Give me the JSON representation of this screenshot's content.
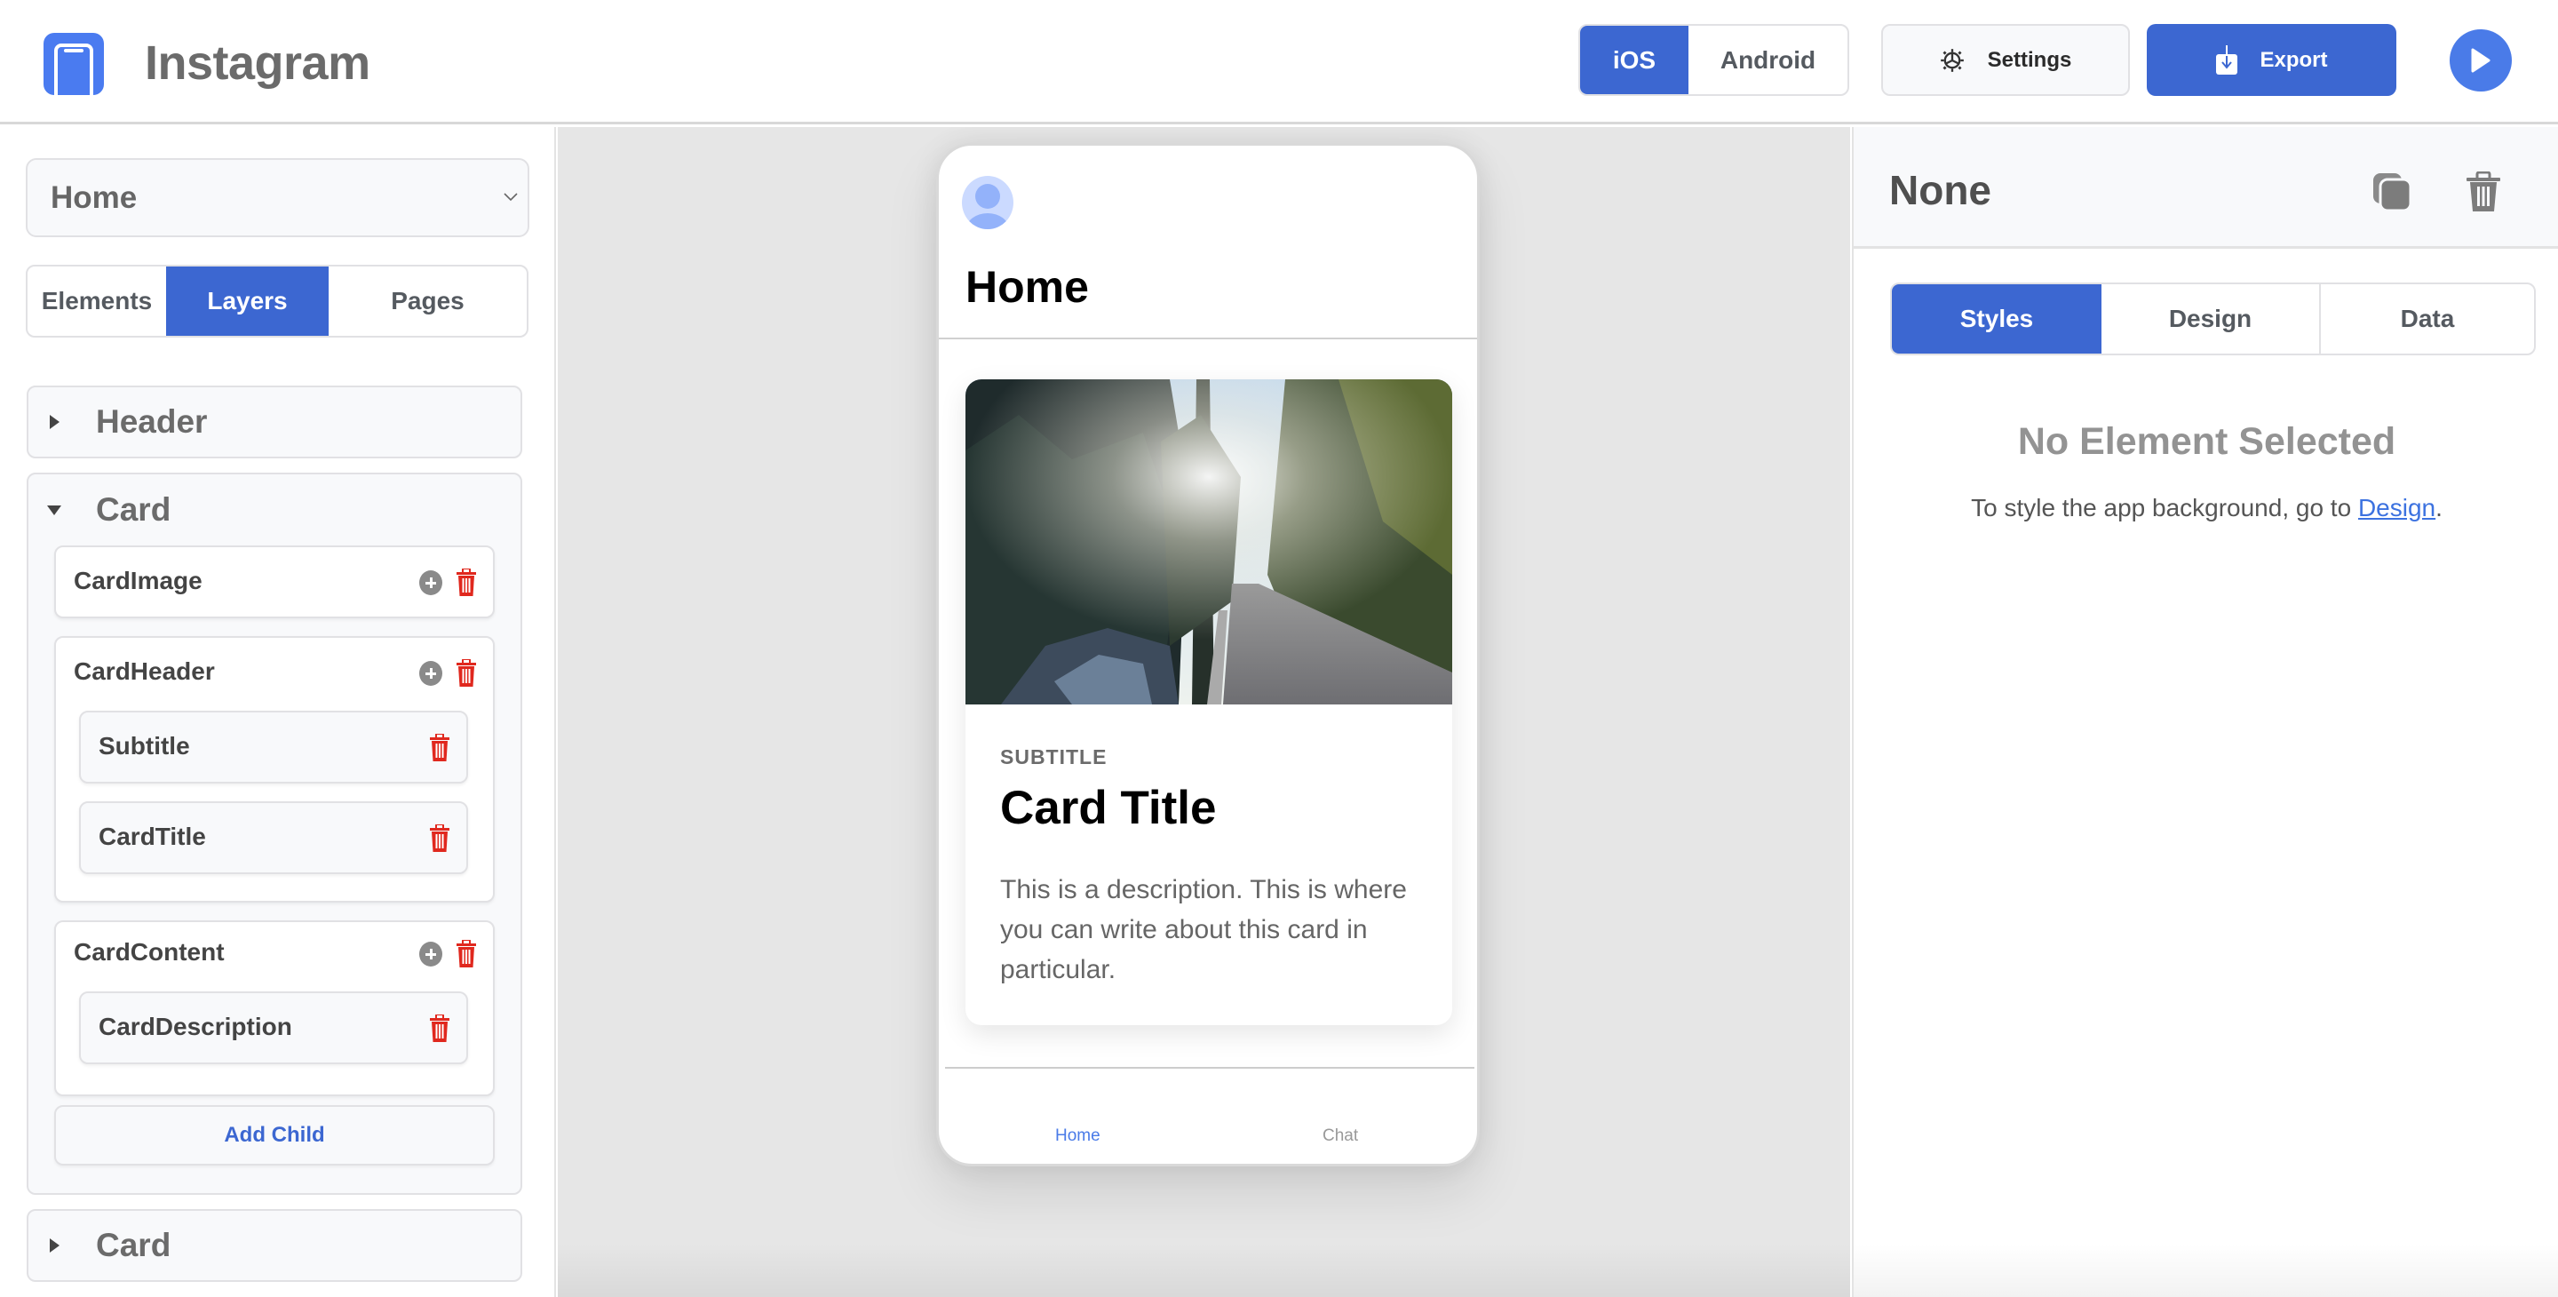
{
  "app": {
    "title": "Instagram",
    "logo_icon": "phone-icon"
  },
  "topbar": {
    "platforms": [
      {
        "label": "iOS",
        "active": true
      },
      {
        "label": "Android",
        "active": false
      }
    ],
    "settings_label": "Settings",
    "settings_icon": "gear-icon",
    "export_label": "Export",
    "export_icon": "download-icon",
    "play_icon": "play-icon"
  },
  "left_panel": {
    "page_select": {
      "value": "Home",
      "icon": "chevron-down-icon"
    },
    "tabs": [
      {
        "label": "Elements",
        "active": false
      },
      {
        "label": "Layers",
        "active": true
      },
      {
        "label": "Pages",
        "active": false
      }
    ],
    "layers": [
      {
        "label": "Header",
        "expanded": false
      },
      {
        "label": "Card",
        "expanded": true,
        "children": [
          {
            "label": "CardImage",
            "children": []
          },
          {
            "label": "CardHeader",
            "children": [
              {
                "label": "Subtitle"
              },
              {
                "label": "CardTitle"
              }
            ]
          },
          {
            "label": "CardContent",
            "children": [
              {
                "label": "CardDescription"
              }
            ]
          }
        ],
        "add_child_label": "Add Child"
      },
      {
        "label": "Card",
        "expanded": false
      }
    ]
  },
  "canvas": {
    "phone": {
      "page_title": "Home",
      "avatar_icon": "user-avatar-icon",
      "card": {
        "image_alt": "Sunlit forest road beside a mountain stream",
        "subtitle": "SUBTITLE",
        "title": "Card Title",
        "description": "This is a description. This is where you can write about this card in particular."
      },
      "tab_bar": [
        {
          "label": "Home",
          "active": true
        },
        {
          "label": "Chat",
          "active": false
        }
      ]
    }
  },
  "right_panel": {
    "selected_name": "None",
    "duplicate_icon": "duplicate-icon",
    "delete_icon": "trash-icon",
    "tabs": [
      {
        "label": "Styles",
        "active": true
      },
      {
        "label": "Design",
        "active": false
      },
      {
        "label": "Data",
        "active": false
      }
    ],
    "empty_title": "No Element Selected",
    "empty_text_prefix": "To style the app background, go to ",
    "empty_text_link": "Design",
    "empty_text_suffix": "."
  },
  "colors": {
    "accent": "#3c67d1",
    "accent_light": "#4a7be8",
    "danger": "#e0281e",
    "muted": "#6b6b6b"
  }
}
